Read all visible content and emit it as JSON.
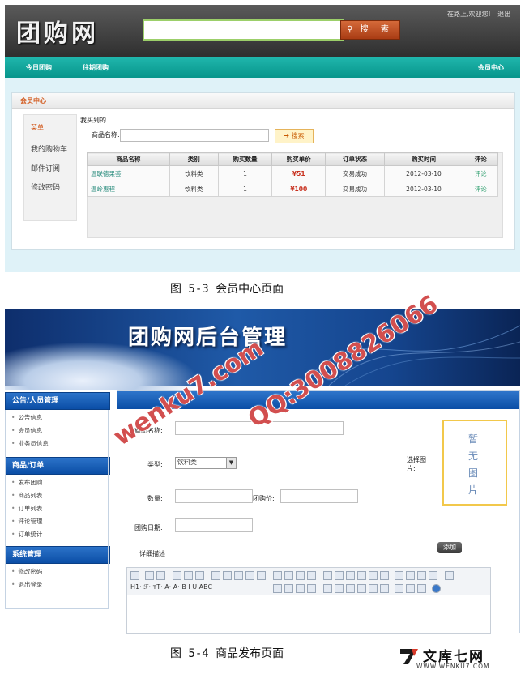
{
  "screen1": {
    "logo": "团购网",
    "search_button": "搜 索",
    "welcome": "在路上,欢迎您!",
    "logout": "退出",
    "nav": [
      "今日团购",
      "往期团购"
    ],
    "nav_right": "会员中心",
    "panel_title": "会员中心",
    "sidebar": [
      "菜单",
      "我的购物车",
      "邮件订阅",
      "修改密码"
    ],
    "my_buys": "我买到的",
    "product_label": "商品名称:",
    "search_small": "搜索",
    "table": {
      "headers": [
        "商品名称",
        "类别",
        "购买数量",
        "购买单价",
        "订单状态",
        "购买时间",
        "评论"
      ],
      "rows": [
        [
          "温联德果荟",
          "饮料类",
          "1",
          "¥51",
          "交易成功",
          "2012-03-10",
          "评论"
        ],
        [
          "温岭惠程",
          "饮料类",
          "1",
          "¥100",
          "交易成功",
          "2012-03-10",
          "评论"
        ]
      ]
    }
  },
  "caption1": "图 5-3 会员中心页面",
  "screen2": {
    "banner_title": "团购网后台管理",
    "groups": [
      {
        "title": "公告/人员管理",
        "links": [
          "公告信息",
          "会员信息",
          "业务员信息"
        ]
      },
      {
        "title": "商品/订单",
        "links": [
          "发布团购",
          "商品列表",
          "订单列表",
          "评论管理",
          "订单统计"
        ]
      },
      {
        "title": "系统管理",
        "links": [
          "修改密码",
          "退出登录"
        ]
      }
    ],
    "form": {
      "name_label": "商品名称:",
      "type_label": "类型:",
      "type_value": "饮料类",
      "qty_label": "数量:",
      "price_label": "团购价:",
      "date_label": "团购日期:",
      "desc_label": "详细描述",
      "image_label": "选择图片:",
      "image_placeholder": "暂无图片",
      "add_button": "添加"
    },
    "toolbar_row2": "H1· ℱ· тT· A· A· B I U ABC"
  },
  "caption2": "图 5-4 商品发布页面",
  "watermarks": {
    "site": "wenku7.com",
    "qq": "QQ:3008826066"
  },
  "footer_logo": {
    "brand": "文库七网",
    "url": "WWW.WENKU7.COM"
  }
}
